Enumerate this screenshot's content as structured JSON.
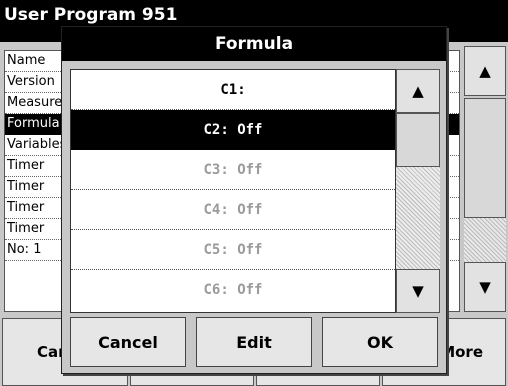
{
  "background": {
    "title": "User Program    951",
    "list_items": [
      "Name",
      "Version",
      "Measurement",
      "Formula",
      "Variables",
      "Timer",
      "Timer",
      "Timer",
      "Timer",
      "No: 1"
    ],
    "bottom_buttons": [
      "Cancel",
      "",
      "",
      "More"
    ]
  },
  "dialog": {
    "title": "Formula",
    "rows": [
      {
        "label": "C1:"
      },
      {
        "label": "C2: Off"
      },
      {
        "label": "C3: Off"
      },
      {
        "label": "C4: Off"
      },
      {
        "label": "C5: Off"
      },
      {
        "label": "C6: Off"
      }
    ],
    "buttons": {
      "cancel": "Cancel",
      "edit": "Edit",
      "ok": "OK"
    }
  },
  "icons": {
    "scroll_up": "triangle-up-icon",
    "scroll_down": "triangle-down-icon"
  }
}
